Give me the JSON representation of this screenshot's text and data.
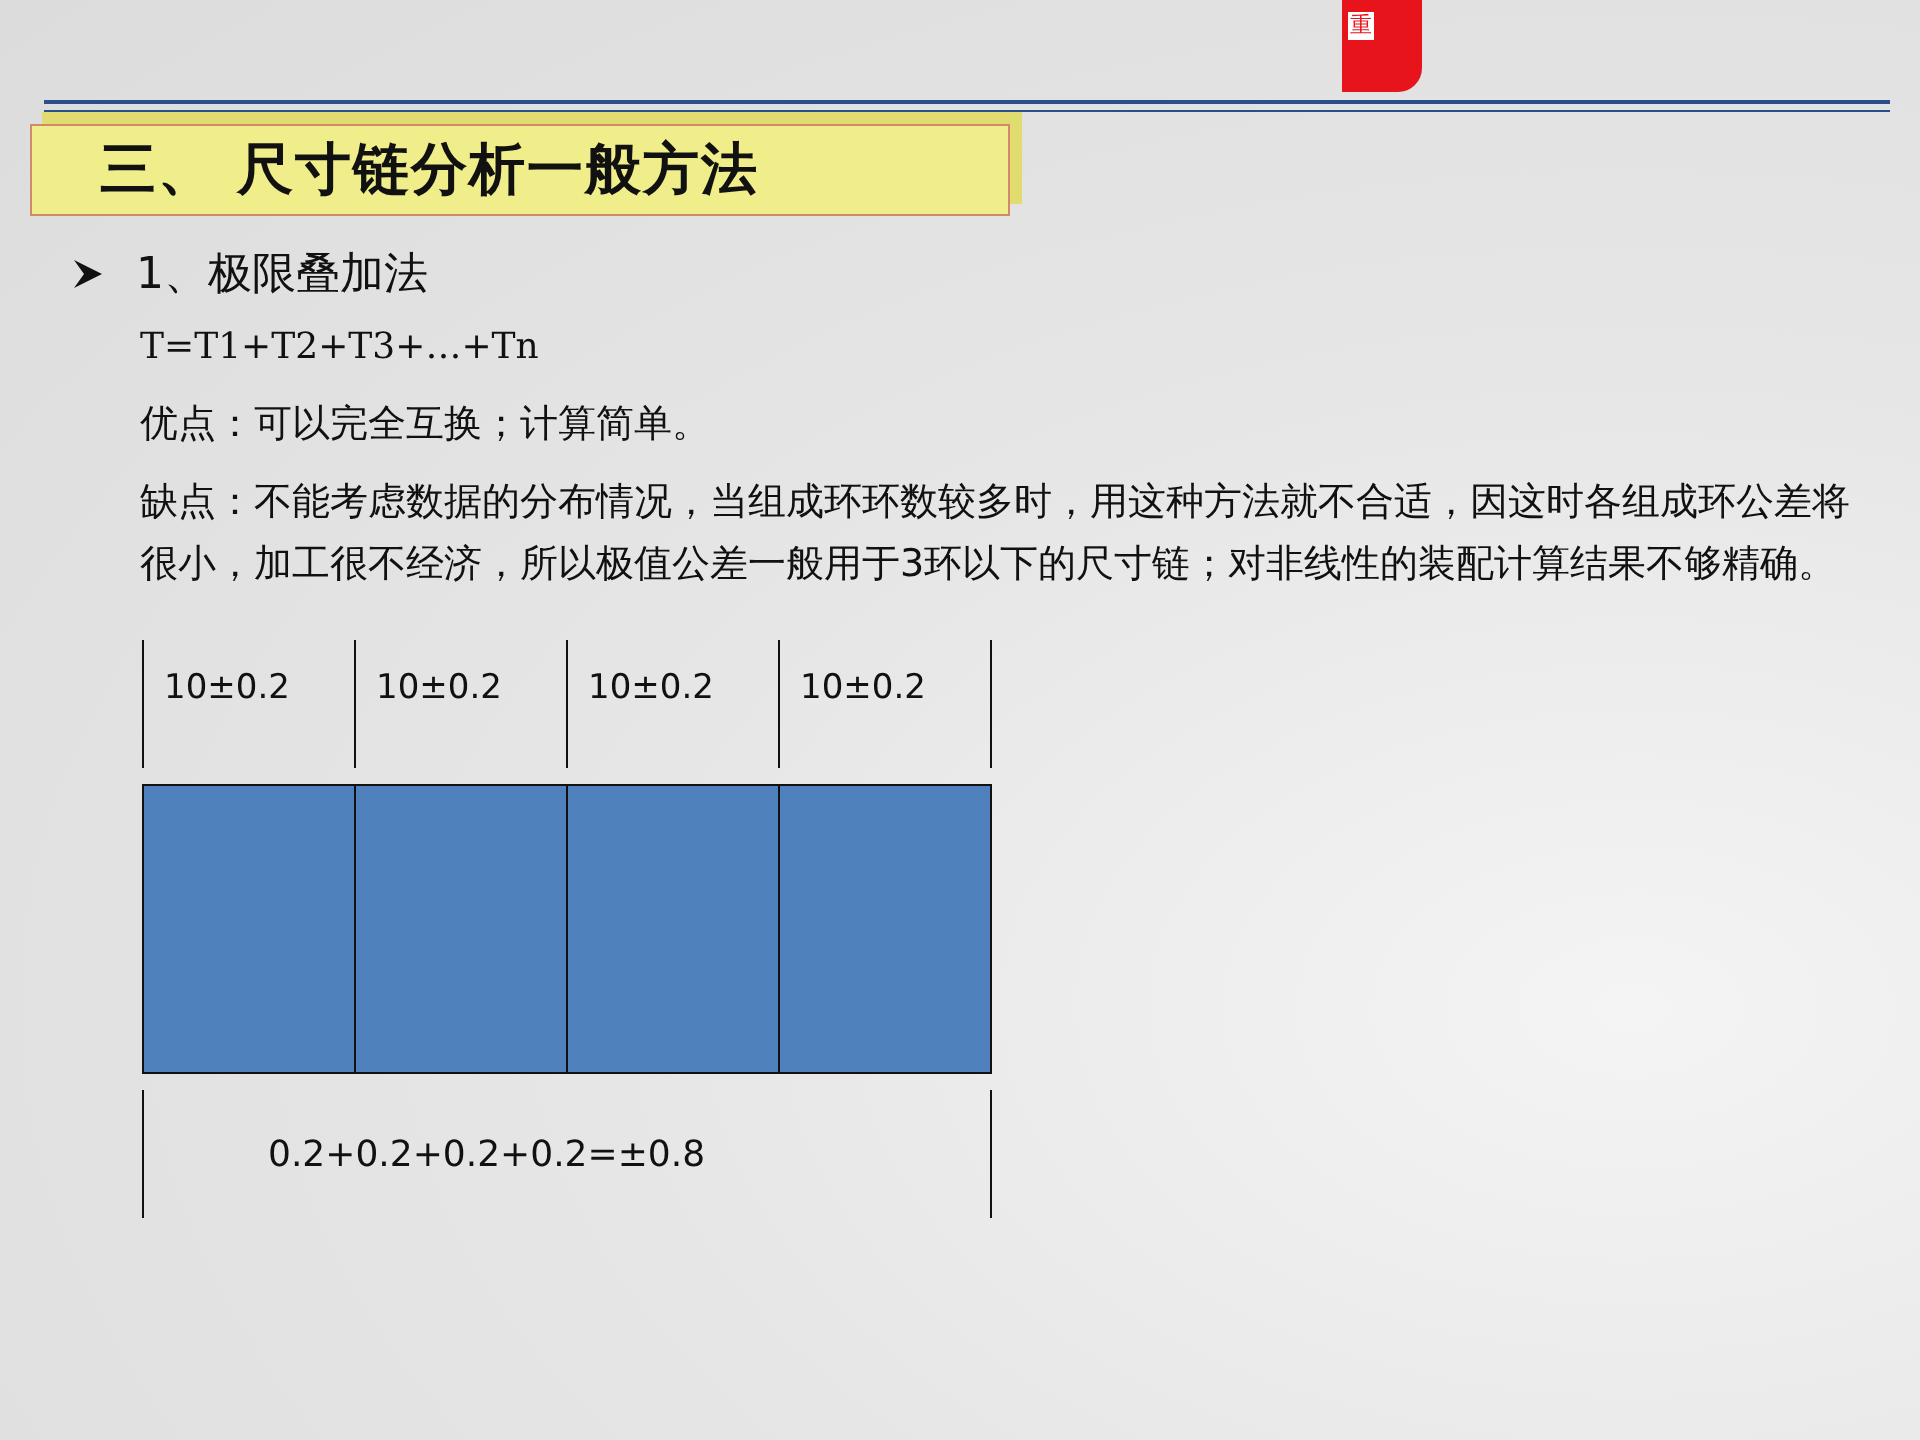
{
  "logo": {
    "text": "重"
  },
  "title": "三、 尺寸链分析一般方法",
  "bullet": {
    "text": "1、极限叠加法"
  },
  "paragraphs": [
    "T=T1+T2+T3+…+Tn",
    "优点：可以完全互换；计算简单。",
    "缺点：不能考虑数据的分布情况，当组成环环数较多时，用这种方法就不合适，因这时各组成环公差将很小，加工很不经济，所以极值公差一般用于3环以下的尺寸链；对非线性的装配计算结果不够精确。"
  ],
  "diagram": {
    "segments": [
      {
        "label": "10±0.2"
      },
      {
        "label": "10±0.2"
      },
      {
        "label": "10±0.2"
      },
      {
        "label": "10±0.2"
      }
    ],
    "total": "0.2+0.2+0.2+0.2=±0.8"
  }
}
